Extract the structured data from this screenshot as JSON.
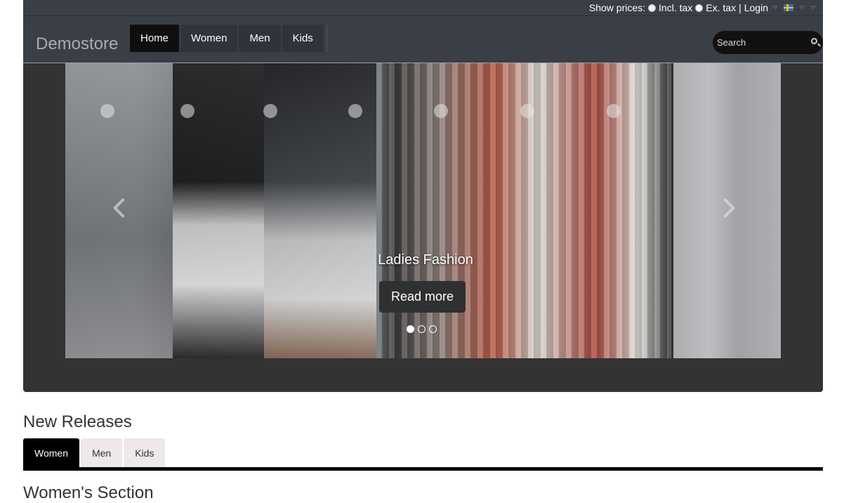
{
  "topbar": {
    "show_prices_label": "Show prices:",
    "incl_tax_label": "Incl. tax",
    "ex_tax_label": "Ex. tax",
    "separator": "|",
    "login_label": "Login"
  },
  "navbar": {
    "brand": "Demostore",
    "items": [
      {
        "label": "Home",
        "active": true
      },
      {
        "label": "Women",
        "active": false
      },
      {
        "label": "Men",
        "active": false
      },
      {
        "label": "Kids",
        "active": false
      }
    ],
    "search_placeholder": "Search"
  },
  "hero": {
    "caption": "Ladies Fashion",
    "read_more_label": "Read more",
    "slide_count": 3,
    "active_slide": 1
  },
  "new_releases": {
    "title": "New Releases",
    "tabs": [
      {
        "label": "Women",
        "active": true
      },
      {
        "label": "Men",
        "active": false
      },
      {
        "label": "Kids",
        "active": false
      }
    ],
    "section_heading": "Women's Section"
  },
  "colors": {
    "navbar_bg": "#3a3f47",
    "hero_bg": "#333333",
    "active_tab": "#000000",
    "inactive_tab": "#eee8e8"
  }
}
